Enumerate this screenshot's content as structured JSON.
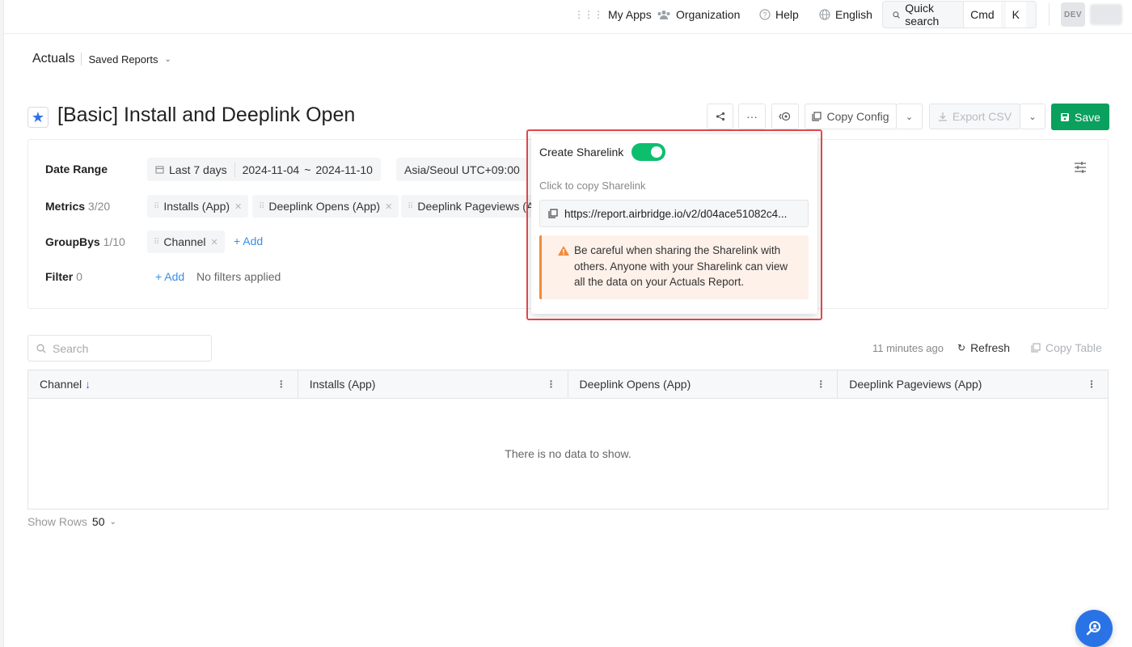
{
  "topbar": {
    "my_apps": "My Apps",
    "organization": "Organization",
    "help": "Help",
    "language": "English",
    "quick_search": "Quick search",
    "kbd_cmd": "Cmd",
    "kbd_k": "K",
    "env_badge": "DEV"
  },
  "breadcrumb": {
    "section": "Actuals",
    "saved_reports": "Saved Reports"
  },
  "report": {
    "title": "[Basic] Install and Deeplink Open",
    "copy_config": "Copy Config",
    "export_csv": "Export CSV",
    "save": "Save"
  },
  "config": {
    "date_range": {
      "label": "Date Range",
      "preset": "Last 7 days",
      "start": "2024-11-04",
      "sep": "~",
      "end": "2024-11-10",
      "timezone": "Asia/Seoul UTC+09:00"
    },
    "metrics": {
      "label": "Metrics",
      "count": "3/20",
      "items": [
        "Installs (App)",
        "Deeplink Opens (App)",
        "Deeplink Pageviews (A"
      ]
    },
    "groupbys": {
      "label": "GroupBys",
      "count": "1/10",
      "items": [
        "Channel"
      ],
      "add_label": "+ Add"
    },
    "filter": {
      "label": "Filter",
      "count": "0",
      "add_label": "+ Add",
      "empty_text": "No filters applied"
    }
  },
  "table": {
    "search_placeholder": "Search",
    "updated": "11 minutes ago",
    "refresh": "Refresh",
    "copy_table": "Copy Table",
    "columns": [
      "Channel",
      "Installs (App)",
      "Deeplink Opens (App)",
      "Deeplink Pageviews (App)"
    ],
    "empty_text": "There is no data to show.",
    "show_rows_label": "Show Rows",
    "show_rows_value": "50"
  },
  "sharelink_popup": {
    "title": "Create Sharelink",
    "enabled": true,
    "hint": "Click to copy Sharelink",
    "url": "https://report.airbridge.io/v2/d04ace51082c4...",
    "warning": "Be careful when sharing the Sharelink with others. Anyone with your Sharelink can view all the data on your Actuals Report."
  },
  "colors": {
    "primary": "#2e73e8",
    "save_green": "#0aa05e",
    "toggle_green": "#0dbf6d",
    "highlight_red": "#e2494e",
    "warning_orange": "#f28a3c"
  }
}
